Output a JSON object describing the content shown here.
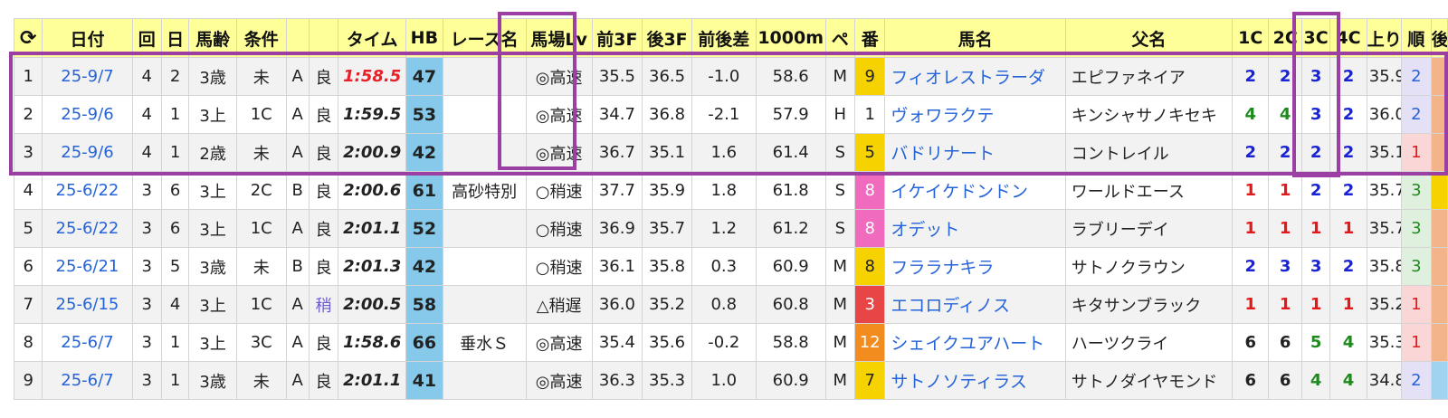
{
  "header": {
    "reload_icon": "⟳",
    "columns": [
      "日付",
      "回",
      "日",
      "馬齢",
      "条件",
      "",
      "",
      "タイム",
      "HB",
      "レース名",
      "馬場Lv",
      "前3F",
      "後3F",
      "前後差",
      "1000m",
      "ペ",
      "番",
      "馬名",
      "父名",
      "1C",
      "2C",
      "3C",
      "4C",
      "上り",
      "順",
      "後"
    ]
  },
  "rows": [
    {
      "no": "1",
      "date": "25-9/7",
      "kai": "4",
      "day": "2",
      "age": "3歳",
      "cond": "未",
      "grade": "A",
      "baba": "良",
      "time": "1:58.5",
      "time_red": true,
      "hb": "47",
      "race": "",
      "lv": "◎高速",
      "f3": "35.5",
      "l3": "36.5",
      "diff": "-1.0",
      "m1000": "58.6",
      "pace": "M",
      "ban": "9",
      "ban_bg": "#f6d200",
      "ban_fg": "#222",
      "horse": "フィオレストラーダ",
      "sire": "エピファネイア",
      "c1": "2",
      "c1c": "c-blue",
      "c2": "2",
      "c2c": "c-blue",
      "c3": "3",
      "c3c": "c-blue",
      "c4": "2",
      "c4c": "c-blue",
      "agari": "35.9",
      "rank": "2",
      "rank_bg": "#e4e0f6",
      "rank_fg": "#2563d8",
      "cut_bg": "#f4b48a"
    },
    {
      "no": "2",
      "date": "25-9/6",
      "kai": "4",
      "day": "1",
      "age": "3上",
      "cond": "1C",
      "grade": "A",
      "baba": "良",
      "time": "1:59.5",
      "time_red": false,
      "hb": "53",
      "race": "",
      "lv": "◎高速",
      "f3": "34.7",
      "l3": "36.8",
      "diff": "-2.1",
      "m1000": "57.9",
      "pace": "H",
      "ban": "1",
      "ban_bg": "#ffffff",
      "ban_fg": "#222",
      "horse": "ヴォワラクテ",
      "sire": "キンシャサノキセキ",
      "c1": "4",
      "c1c": "c-green",
      "c2": "4",
      "c2c": "c-green",
      "c3": "3",
      "c3c": "c-blue",
      "c4": "2",
      "c4c": "c-blue",
      "agari": "36.0",
      "rank": "2",
      "rank_bg": "#e4e0f6",
      "rank_fg": "#2563d8",
      "cut_bg": "#f4b48a"
    },
    {
      "no": "3",
      "date": "25-9/6",
      "kai": "4",
      "day": "1",
      "age": "2歳",
      "cond": "未",
      "grade": "A",
      "baba": "良",
      "time": "2:00.9",
      "time_red": false,
      "hb": "42",
      "race": "",
      "lv": "◎高速",
      "f3": "36.7",
      "l3": "35.1",
      "diff": "1.6",
      "m1000": "61.4",
      "pace": "S",
      "ban": "5",
      "ban_bg": "#f6d200",
      "ban_fg": "#222",
      "horse": "バドリナート",
      "sire": "コントレイル",
      "c1": "2",
      "c1c": "c-blue",
      "c2": "2",
      "c2c": "c-blue",
      "c3": "2",
      "c3c": "c-blue",
      "c4": "2",
      "c4c": "c-blue",
      "agari": "35.1",
      "rank": "1",
      "rank_bg": "#fbd6d6",
      "rank_fg": "#e01a1a",
      "cut_bg": "#f4b48a"
    },
    {
      "no": "4",
      "date": "25-6/22",
      "kai": "3",
      "day": "6",
      "age": "3上",
      "cond": "2C",
      "grade": "B",
      "baba": "良",
      "time": "2:00.6",
      "time_red": false,
      "hb": "61",
      "race": "高砂特別",
      "lv": "○稍速",
      "f3": "37.7",
      "l3": "35.9",
      "diff": "1.8",
      "m1000": "61.8",
      "pace": "S",
      "ban": "8",
      "ban_bg": "#f06bbd",
      "ban_fg": "#ffffff",
      "horse": "イケイケドンドン",
      "sire": "ワールドエース",
      "c1": "1",
      "c1c": "c-red",
      "c2": "1",
      "c2c": "c-red",
      "c3": "2",
      "c3c": "c-blue",
      "c4": "2",
      "c4c": "c-blue",
      "agari": "35.7",
      "rank": "3",
      "rank_bg": "#dff0df",
      "rank_fg": "#1e8a1e",
      "cut_bg": "#f6d200"
    },
    {
      "no": "5",
      "date": "25-6/22",
      "kai": "3",
      "day": "6",
      "age": "3上",
      "cond": "1C",
      "grade": "A",
      "baba": "良",
      "time": "2:01.1",
      "time_red": false,
      "hb": "52",
      "race": "",
      "lv": "○稍速",
      "f3": "36.9",
      "l3": "35.7",
      "diff": "1.2",
      "m1000": "61.2",
      "pace": "S",
      "ban": "8",
      "ban_bg": "#f06bbd",
      "ban_fg": "#ffffff",
      "horse": "オデット",
      "sire": "ラブリーデイ",
      "c1": "1",
      "c1c": "c-red",
      "c2": "1",
      "c2c": "c-red",
      "c3": "1",
      "c3c": "c-red",
      "c4": "1",
      "c4c": "c-red",
      "agari": "35.7",
      "rank": "3",
      "rank_bg": "#dff0df",
      "rank_fg": "#1e8a1e",
      "cut_bg": "#f4b48a"
    },
    {
      "no": "6",
      "date": "25-6/21",
      "kai": "3",
      "day": "5",
      "age": "3歳",
      "cond": "未",
      "grade": "B",
      "baba": "良",
      "time": "2:01.3",
      "time_red": false,
      "hb": "42",
      "race": "",
      "lv": "○稍速",
      "f3": "36.1",
      "l3": "35.8",
      "diff": "0.3",
      "m1000": "60.9",
      "pace": "M",
      "ban": "8",
      "ban_bg": "#f6d200",
      "ban_fg": "#222",
      "horse": "フララナキラ",
      "sire": "サトノクラウン",
      "c1": "2",
      "c1c": "c-blue",
      "c2": "3",
      "c2c": "c-blue",
      "c3": "3",
      "c3c": "c-blue",
      "c4": "2",
      "c4c": "c-blue",
      "agari": "35.8",
      "rank": "3",
      "rank_bg": "#dff0df",
      "rank_fg": "#1e8a1e",
      "cut_bg": "#f4b48a"
    },
    {
      "no": "7",
      "date": "25-6/15",
      "kai": "3",
      "day": "4",
      "age": "3上",
      "cond": "1C",
      "grade": "A",
      "baba": "稍",
      "time": "2:00.5",
      "time_red": false,
      "hb": "58",
      "race": "",
      "lv": "△稍遅",
      "f3": "36.0",
      "l3": "35.2",
      "diff": "0.8",
      "m1000": "60.8",
      "pace": "M",
      "ban": "3",
      "ban_bg": "#e84646",
      "ban_fg": "#ffffff",
      "horse": "エコロディノス",
      "sire": "キタサンブラック",
      "c1": "1",
      "c1c": "c-red",
      "c2": "1",
      "c2c": "c-red",
      "c3": "1",
      "c3c": "c-red",
      "c4": "1",
      "c4c": "c-red",
      "agari": "35.2",
      "rank": "1",
      "rank_bg": "#fbd6d6",
      "rank_fg": "#e01a1a",
      "cut_bg": "#f4b48a"
    },
    {
      "no": "8",
      "date": "25-6/7",
      "kai": "3",
      "day": "1",
      "age": "3上",
      "cond": "3C",
      "grade": "A",
      "baba": "良",
      "time": "1:58.6",
      "time_red": false,
      "hb": "66",
      "race": "垂水Ｓ",
      "lv": "◎高速",
      "f3": "35.4",
      "l3": "35.6",
      "diff": "-0.2",
      "m1000": "58.8",
      "pace": "M",
      "ban": "12",
      "ban_bg": "#f28c1e",
      "ban_fg": "#ffffff",
      "horse": "シェイクユアハート",
      "sire": "ハーツクライ",
      "c1": "6",
      "c1c": "c-black",
      "c2": "6",
      "c2c": "c-black",
      "c3": "5",
      "c3c": "c-green",
      "c4": "4",
      "c4c": "c-green",
      "agari": "35.3",
      "rank": "1",
      "rank_bg": "#fbd6d6",
      "rank_fg": "#e01a1a",
      "cut_bg": "#f4b48a"
    },
    {
      "no": "9",
      "date": "25-6/7",
      "kai": "3",
      "day": "1",
      "age": "3歳",
      "cond": "未",
      "grade": "A",
      "baba": "良",
      "time": "2:01.1",
      "time_red": false,
      "hb": "41",
      "race": "",
      "lv": "◎高速",
      "f3": "36.3",
      "l3": "35.3",
      "diff": "1.0",
      "m1000": "60.9",
      "pace": "M",
      "ban": "7",
      "ban_bg": "#f6d200",
      "ban_fg": "#222",
      "horse": "サトノソティラス",
      "sire": "サトノダイヤモンド",
      "c1": "6",
      "c1c": "c-black",
      "c2": "6",
      "c2c": "c-black",
      "c3": "4",
      "c3c": "c-green",
      "c4": "4",
      "c4c": "c-green",
      "agari": "34.8",
      "rank": "2",
      "rank_bg": "#e4e0f6",
      "rank_fg": "#2563d8",
      "cut_bg": "#9fd3f0"
    }
  ],
  "colors": {
    "header_bg": "#ffff99",
    "hb_bg": "#86c9ea",
    "selection": "#9b3fa5",
    "link": "#2563d8"
  }
}
